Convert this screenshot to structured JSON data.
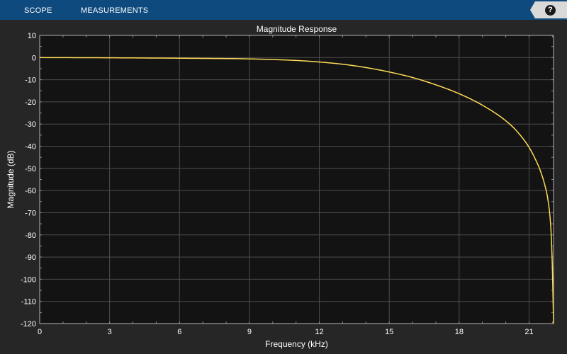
{
  "toolbar": {
    "tabs": [
      {
        "label": "SCOPE"
      },
      {
        "label": "MEASUREMENTS"
      }
    ],
    "help_label": "?"
  },
  "colors": {
    "toolbar": "#0e4a7d",
    "background": "#262626",
    "plot_area": "#131313",
    "grid": "#4d4d4d",
    "text": "#ffffff",
    "line": "#ffdc55"
  },
  "chart_data": {
    "type": "line",
    "title": "Magnitude Response",
    "xlabel": "Frequency (kHz)",
    "ylabel": "Magnitude (dB)",
    "xlim": [
      0,
      22.05
    ],
    "ylim": [
      -120,
      10
    ],
    "xticks": [
      0,
      3,
      6,
      9,
      12,
      15,
      18,
      21
    ],
    "yticks": [
      10,
      0,
      -10,
      -20,
      -30,
      -40,
      -50,
      -60,
      -70,
      -80,
      -90,
      -100,
      -110,
      -120
    ],
    "grid": true,
    "series": [
      {
        "x": [
          0,
          3,
          6,
          9,
          10,
          11,
          12,
          13,
          14,
          15,
          16,
          17,
          18,
          19,
          20,
          20.5,
          21,
          21.3,
          21.5,
          21.7,
          21.8,
          21.9,
          21.95,
          22.0,
          22.05
        ],
        "y": [
          0,
          -0.1,
          -0.3,
          -0.6,
          -0.9,
          -1.3,
          -2.0,
          -3.0,
          -4.5,
          -6.5,
          -9.0,
          -12.3,
          -16.3,
          -21.5,
          -28.5,
          -33.5,
          -40.5,
          -46.5,
          -51.5,
          -58.5,
          -63.5,
          -72,
          -80,
          -95,
          -120
        ]
      }
    ]
  }
}
